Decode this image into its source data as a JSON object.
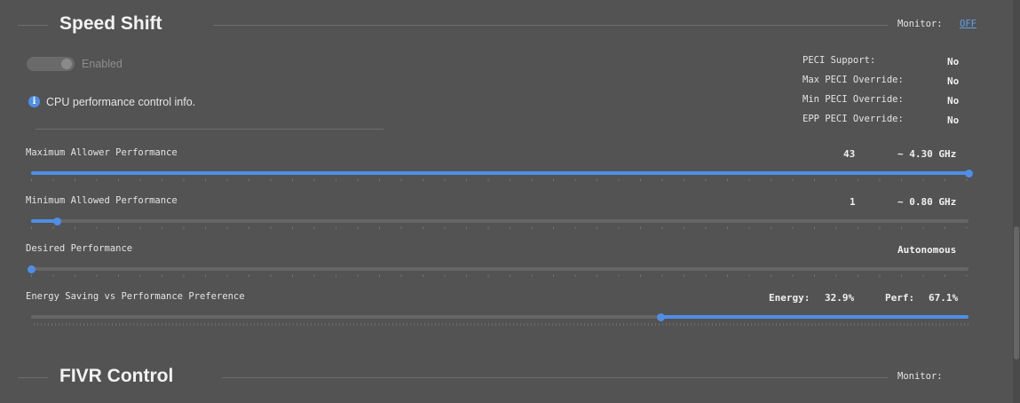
{
  "speed_shift": {
    "title": "Speed Shift",
    "monitor_label": "Monitor:",
    "monitor_value": "OFF",
    "enabled_label": "Enabled",
    "info_text": "CPU performance control info.",
    "peci": [
      {
        "label": "PECI Support:",
        "value": "No"
      },
      {
        "label": "Max PECI Override:",
        "value": "No"
      },
      {
        "label": "Min PECI Override:",
        "value": "No"
      },
      {
        "label": "EPP PECI Override:",
        "value": "No"
      }
    ],
    "sliders": {
      "max": {
        "label": "Maximum Allower Performance",
        "value": "43",
        "freq": "~ 4.30 GHz",
        "fraction": 1.0
      },
      "min": {
        "label": "Minimum Allowed Performance",
        "value": "1",
        "freq": "~ 0.80 GHz",
        "fraction": 0.027
      },
      "desired": {
        "label": "Desired Performance",
        "value": "Autonomous",
        "fraction": 0.0
      },
      "epp": {
        "label": "Energy Saving vs Performance Preference",
        "energy_label": "Energy:",
        "energy_value": "32.9%",
        "perf_label": "Perf:",
        "perf_value": "67.1%",
        "fraction": 0.671
      }
    }
  },
  "fivr": {
    "title": "FIVR Control",
    "monitor_label": "Monitor:"
  },
  "colors": {
    "background": "#535353",
    "accent": "#4f8ee6"
  }
}
